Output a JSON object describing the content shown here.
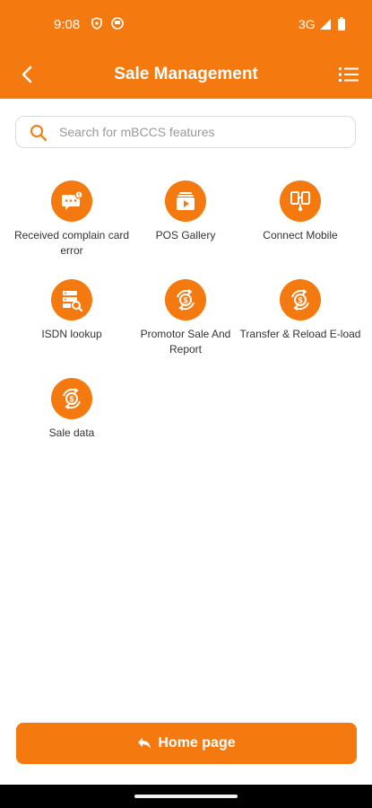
{
  "status_bar": {
    "time": "9:08",
    "network": "3G"
  },
  "header": {
    "title": "Sale Management"
  },
  "search": {
    "placeholder": "Search for mBCCS features"
  },
  "features": [
    {
      "label": "Received complain card error",
      "icon": "complaint-chat-icon"
    },
    {
      "label": "POS Gallery",
      "icon": "gallery-play-icon"
    },
    {
      "label": "Connect Mobile",
      "icon": "connect-mobile-icon"
    },
    {
      "label": "ISDN lookup",
      "icon": "server-search-icon"
    },
    {
      "label": "Promotor Sale And Report",
      "icon": "money-exchange-icon"
    },
    {
      "label": "Transfer & Reload E-load",
      "icon": "money-exchange-icon"
    },
    {
      "label": "Sale data",
      "icon": "money-exchange-icon"
    }
  ],
  "home_button": {
    "label": "Home page"
  },
  "colors": {
    "brand": "#f47a0f"
  }
}
